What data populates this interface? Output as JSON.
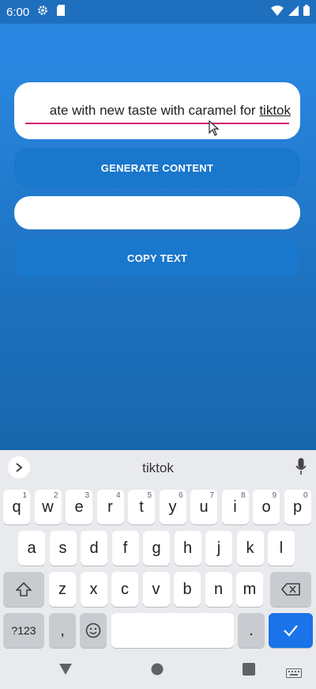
{
  "status_bar": {
    "time": "6:00",
    "left_icons": [
      "gear-icon",
      "sd-card-icon"
    ],
    "right_icons": [
      "wifi-icon",
      "signal-icon",
      "battery-icon"
    ]
  },
  "entry_top": {
    "value_plain": "ate with new taste with caramel for ",
    "value_underlined": "tiktok"
  },
  "buttons": {
    "generate": "GENERATE CONTENT",
    "copy": "COPY TEXT"
  },
  "entry_bottom": {
    "value": ""
  },
  "keyboard": {
    "suggestion": "tiktok",
    "row1": [
      {
        "k": "q",
        "s": "1"
      },
      {
        "k": "w",
        "s": "2"
      },
      {
        "k": "e",
        "s": "3"
      },
      {
        "k": "r",
        "s": "4"
      },
      {
        "k": "t",
        "s": "5"
      },
      {
        "k": "y",
        "s": "6"
      },
      {
        "k": "u",
        "s": "7"
      },
      {
        "k": "i",
        "s": "8"
      },
      {
        "k": "o",
        "s": "9"
      },
      {
        "k": "p",
        "s": "0"
      }
    ],
    "row2": [
      "a",
      "s",
      "d",
      "f",
      "g",
      "h",
      "j",
      "k",
      "l"
    ],
    "row3": [
      "z",
      "x",
      "c",
      "v",
      "b",
      "n",
      "m"
    ],
    "symbols_label": "?123",
    "comma": ",",
    "period": "."
  },
  "colors": {
    "accent": "#1a73e8",
    "underline": "#d0266f",
    "button": "#1977cc"
  }
}
